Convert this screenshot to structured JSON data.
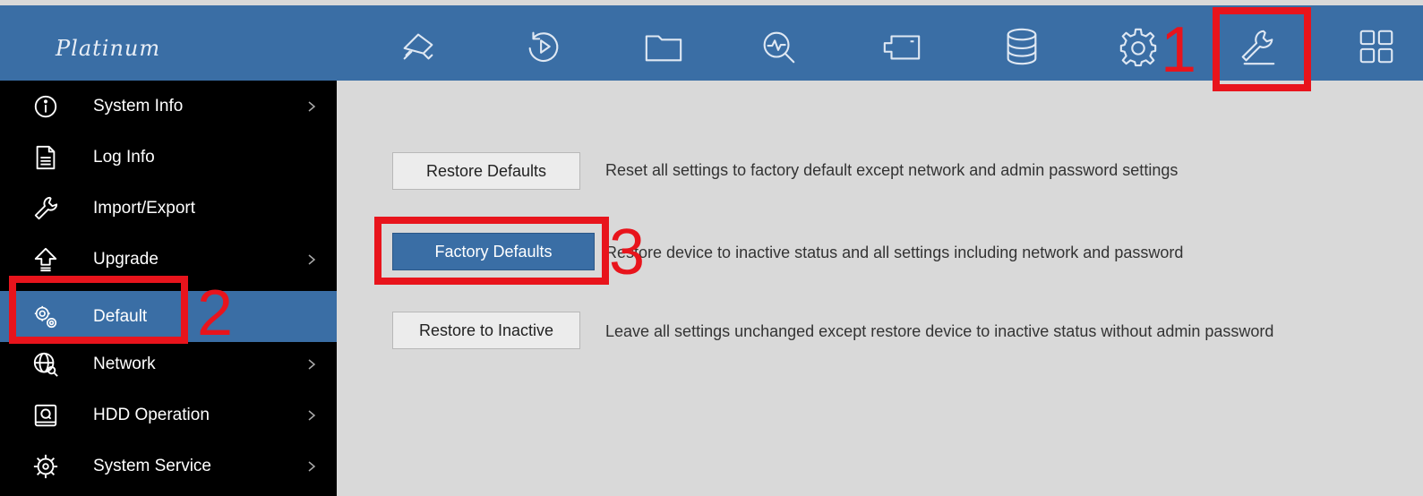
{
  "brand": {
    "logo_text": "Platinum"
  },
  "topbar": {
    "icons": [
      {
        "name": "camera-icon"
      },
      {
        "name": "playback-icon"
      },
      {
        "name": "folder-icon"
      },
      {
        "name": "search-analytics-icon"
      },
      {
        "name": "video-camera-icon"
      },
      {
        "name": "database-icon"
      },
      {
        "name": "gear-icon"
      },
      {
        "name": "wrench-icon",
        "selected": true
      },
      {
        "name": "grid-icon"
      }
    ]
  },
  "sidebar": {
    "items": [
      {
        "label": "System Info",
        "icon": "info-icon",
        "has_submenu": true
      },
      {
        "label": "Log Info",
        "icon": "document-icon",
        "has_submenu": false
      },
      {
        "label": "Import/Export",
        "icon": "wrench-icon",
        "has_submenu": false
      },
      {
        "label": "Upgrade",
        "icon": "upgrade-arrow-icon",
        "has_submenu": true
      },
      {
        "label": "Default",
        "icon": "gears-icon",
        "has_submenu": false,
        "active": true
      },
      {
        "label": "Network",
        "icon": "globe-search-icon",
        "has_submenu": true
      },
      {
        "label": "HDD Operation",
        "icon": "hdd-icon",
        "has_submenu": true
      },
      {
        "label": "System Service",
        "icon": "service-gear-icon",
        "has_submenu": true
      }
    ]
  },
  "main": {
    "options": [
      {
        "button": "Restore Defaults",
        "description": "Reset all settings to factory default except network and admin password settings"
      },
      {
        "button": "Factory Defaults",
        "description": "Restore device to inactive status and all settings including network and password"
      },
      {
        "button": "Restore to Inactive",
        "description": "Leave all settings unchanged except restore device to inactive status without admin password"
      }
    ]
  },
  "annotations": {
    "step1": "1",
    "step2": "2",
    "step3": "3"
  },
  "colors": {
    "topbar": "#3a6ea5",
    "sidebar": "#000000",
    "active": "#3a6ea5",
    "content_bg": "#d9d9d9",
    "annotation": "#e8141c"
  }
}
